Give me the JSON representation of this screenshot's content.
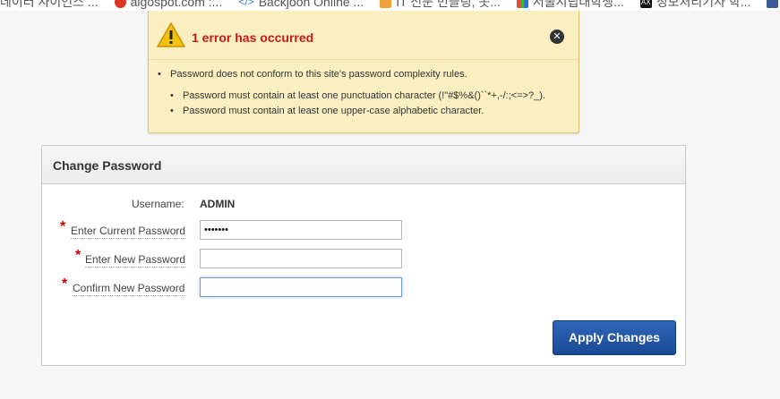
{
  "bookmarks": [
    {
      "label": "데이터 사이언스 ...",
      "icon": "doc-icon"
    },
    {
      "label": "algospot.com :...",
      "icon": "algospot-icon"
    },
    {
      "label": "Backjoon Online ...",
      "icon": "code-icon"
    },
    {
      "label": "IT 전문 번들링, 못...",
      "icon": "bookmark-icon"
    },
    {
      "label": "서울시립대학생...",
      "icon": "google-icon"
    },
    {
      "label": "정보처리기사 학...",
      "icon": "ax-icon"
    }
  ],
  "error": {
    "title": "1 error has occurred",
    "main_message": "Password does not conform to this site's password complexity rules.",
    "details": [
      "Password must contain at least one punctuation character (!\"#$%&()``*+,-/:;<=>?_).",
      "Password must contain at least one upper-case alphabetic character."
    ]
  },
  "form": {
    "title": "Change Password",
    "username_label": "Username:",
    "username_value": "ADMIN",
    "current_password_label": "Enter Current Password",
    "current_password_value": "•••••••",
    "new_password_label": "Enter New Password",
    "new_password_value": "",
    "confirm_password_label": "Confirm New Password",
    "confirm_password_value": "",
    "required_marker": "*",
    "apply_label": "Apply Changes"
  },
  "colors": {
    "error_bg": "#fbefc2",
    "error_title": "#c41a1a",
    "button_blue": "#1f57a8",
    "required_red": "#d40000"
  }
}
